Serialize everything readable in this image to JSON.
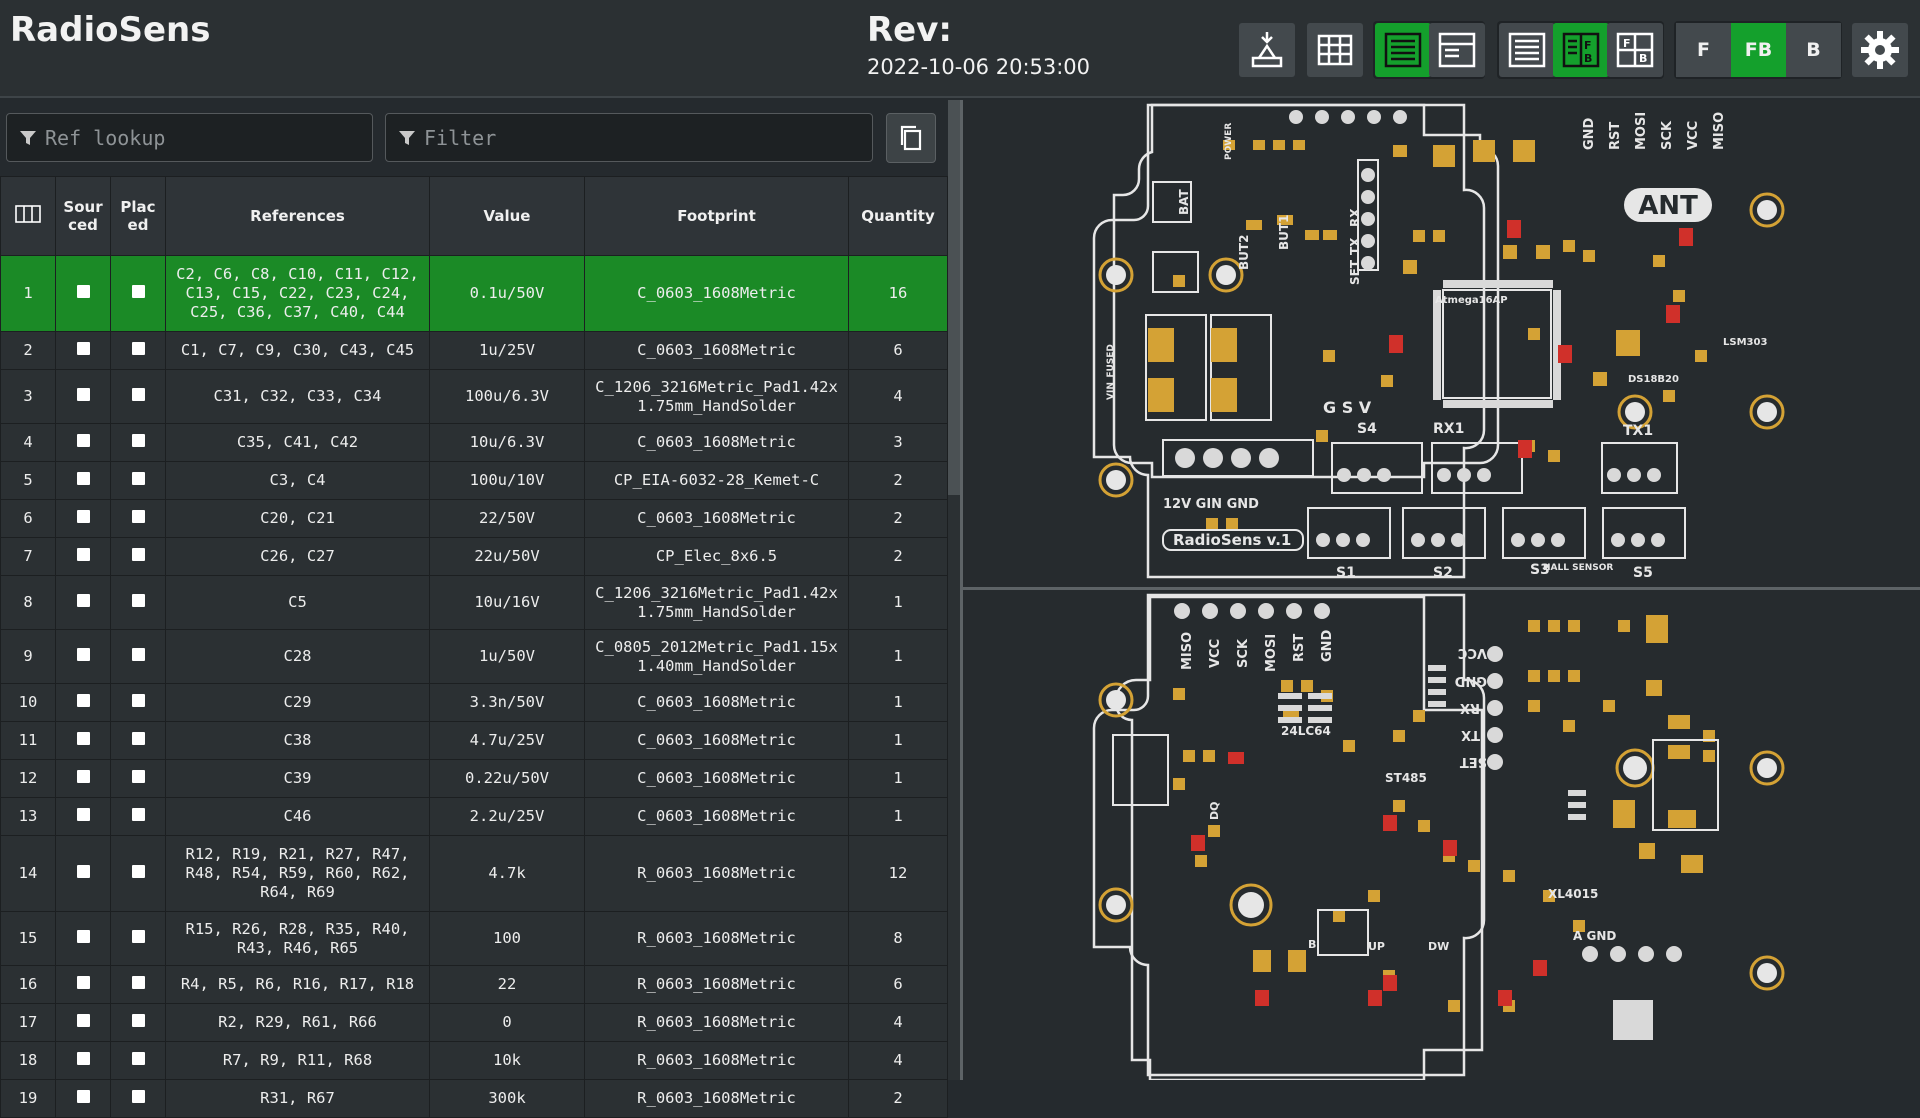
{
  "header": {
    "title": "RadioSens",
    "rev_label": "Rev:",
    "rev_date": "2022-10-06 20:53:00"
  },
  "toolbar": {
    "buttons": [
      {
        "name": "dark-mode-icon"
      },
      {
        "name": "grid-icon"
      },
      {
        "name": "layout-bom-only-icon",
        "active": true
      },
      {
        "name": "layout-left-right-icon"
      },
      {
        "name": "bom-list-icon"
      },
      {
        "name": "bom-front-back-icon",
        "active": true
      },
      {
        "name": "bom-split-icon"
      }
    ],
    "layers": [
      "F",
      "FB",
      "B"
    ],
    "active_layer": "FB",
    "settings_icon": "gear-icon"
  },
  "search": {
    "ref_placeholder": "Ref lookup",
    "filter_placeholder": "Filter"
  },
  "table": {
    "headers": [
      "",
      "Sour ced",
      "Plac ed",
      "References",
      "Value",
      "Footprint",
      "Quantity"
    ],
    "rows": [
      {
        "n": "1",
        "refs": "C2, C6, C8, C10, C11, C12, C13, C15, C22, C23, C24, C25, C36, C37, C40, C44",
        "value": "0.1u/50V",
        "footprint": "C_0603_1608Metric",
        "qty": "16"
      },
      {
        "n": "2",
        "refs": "C1, C7, C9, C30, C43, C45",
        "value": "1u/25V",
        "footprint": "C_0603_1608Metric",
        "qty": "6"
      },
      {
        "n": "3",
        "refs": "C31, C32, C33, C34",
        "value": "100u/6.3V",
        "footprint": "C_1206_3216Metric_Pad1.42x1.75mm_HandSolder",
        "qty": "4"
      },
      {
        "n": "4",
        "refs": "C35, C41, C42",
        "value": "10u/6.3V",
        "footprint": "C_0603_1608Metric",
        "qty": "3"
      },
      {
        "n": "5",
        "refs": "C3, C4",
        "value": "100u/10V",
        "footprint": "CP_EIA-6032-28_Kemet-C",
        "qty": "2"
      },
      {
        "n": "6",
        "refs": "C20, C21",
        "value": "22/50V",
        "footprint": "C_0603_1608Metric",
        "qty": "2"
      },
      {
        "n": "7",
        "refs": "C26, C27",
        "value": "22u/50V",
        "footprint": "CP_Elec_8x6.5",
        "qty": "2"
      },
      {
        "n": "8",
        "refs": "C5",
        "value": "10u/16V",
        "footprint": "C_1206_3216Metric_Pad1.42x1.75mm_HandSolder",
        "qty": "1"
      },
      {
        "n": "9",
        "refs": "C28",
        "value": "1u/50V",
        "footprint": "C_0805_2012Metric_Pad1.15x1.40mm_HandSolder",
        "qty": "1"
      },
      {
        "n": "10",
        "refs": "C29",
        "value": "3.3n/50V",
        "footprint": "C_0603_1608Metric",
        "qty": "1"
      },
      {
        "n": "11",
        "refs": "C38",
        "value": "4.7u/25V",
        "footprint": "C_0603_1608Metric",
        "qty": "1"
      },
      {
        "n": "12",
        "refs": "C39",
        "value": "0.22u/50V",
        "footprint": "C_0603_1608Metric",
        "qty": "1"
      },
      {
        "n": "13",
        "refs": "C46",
        "value": "2.2u/25V",
        "footprint": "C_0603_1608Metric",
        "qty": "1"
      },
      {
        "n": "14",
        "refs": "R12, R19, R21, R27, R47, R48, R54, R59, R60, R62, R64, R69",
        "value": "4.7k",
        "footprint": "R_0603_1608Metric",
        "qty": "12"
      },
      {
        "n": "15",
        "refs": "R15, R26, R28, R35, R40, R43, R46, R65",
        "value": "100",
        "footprint": "R_0603_1608Metric",
        "qty": "8"
      },
      {
        "n": "16",
        "refs": "R4, R5, R6, R16, R17, R18",
        "value": "22",
        "footprint": "R_0603_1608Metric",
        "qty": "6"
      },
      {
        "n": "17",
        "refs": "R2, R29, R61, R66",
        "value": "0",
        "footprint": "R_0603_1608Metric",
        "qty": "4"
      },
      {
        "n": "18",
        "refs": "R7, R9, R11, R68",
        "value": "10k",
        "footprint": "R_0603_1608Metric",
        "qty": "4"
      },
      {
        "n": "19",
        "refs": "R31, R67",
        "value": "300k",
        "footprint": "R_0603_1608Metric",
        "qty": "2"
      }
    ]
  },
  "pcb_front": {
    "labels": [
      "ANT",
      "RadioSens v.1",
      "12V GIN GND",
      "S1",
      "S2",
      "S3",
      "S4",
      "S5",
      "RX1",
      "TX1",
      "G S V",
      "GND",
      "RST",
      "MOSI",
      "SCK",
      "VCC",
      "MISO",
      "Atmega16AP",
      "DS18B20",
      "LSM303",
      "BUT1",
      "BUT2",
      "SET",
      "TX",
      "RX",
      "VIN_FUSED",
      "POWER",
      "HALL SENSOR",
      "BAT"
    ]
  },
  "pcb_back": {
    "labels": [
      "MISO",
      "VCC",
      "SCK",
      "MOSI",
      "RST",
      "GND",
      "VCC",
      "GND",
      "RX",
      "TX",
      "SET",
      "24LC64",
      "ST485",
      "XL4015",
      "A GND",
      "UP",
      "DW",
      "DQ",
      "B"
    ]
  },
  "colors": {
    "highlight": "#1b8a26",
    "active_button": "#14a02c",
    "pcb_edge": "#e6e6e6",
    "pad": "#d4a235",
    "pad_selected": "#d0302a"
  }
}
